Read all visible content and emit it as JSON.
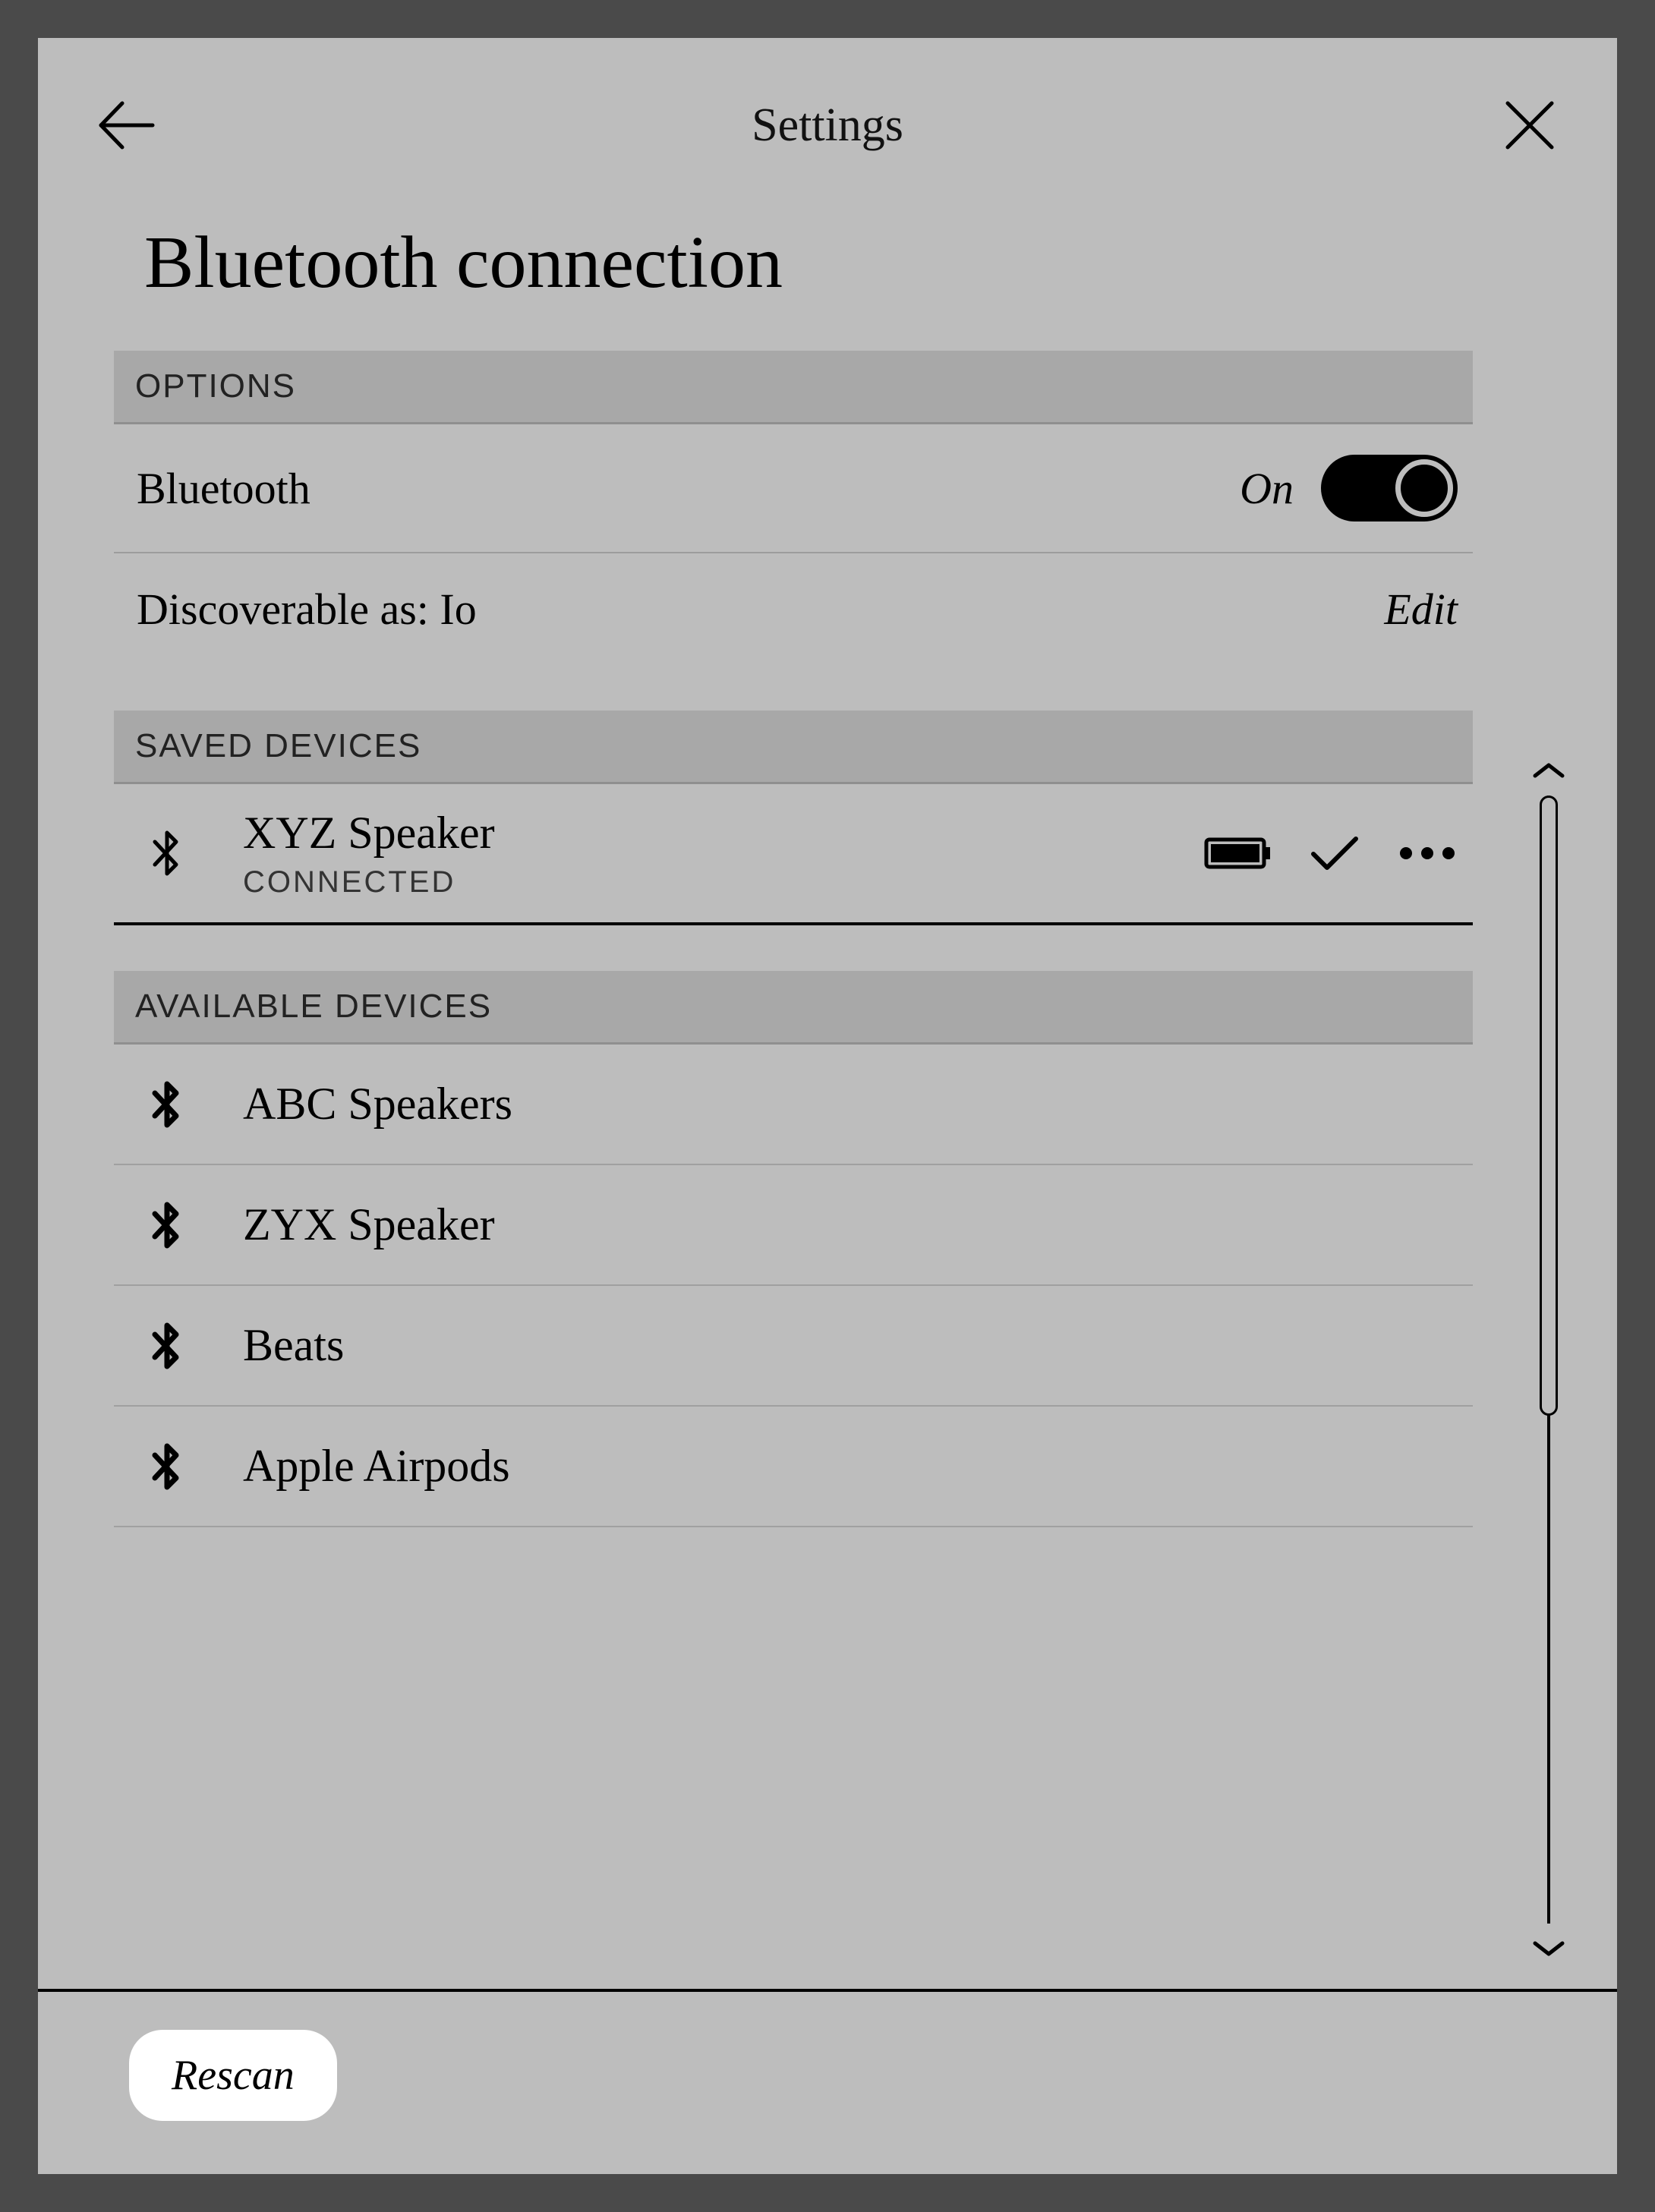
{
  "header": {
    "title": "Settings"
  },
  "page": {
    "title": "Bluetooth connection"
  },
  "sections": {
    "options_header": "OPTIONS",
    "saved_header": "SAVED DEVICES",
    "available_header": "AVAILABLE DEVICES"
  },
  "options": {
    "bluetooth_label": "Bluetooth",
    "bluetooth_state": "On",
    "discoverable_label": "Discoverable as: Io",
    "edit_label": "Edit"
  },
  "saved_devices": [
    {
      "name": "XYZ Speaker",
      "status": "CONNECTED"
    }
  ],
  "available_devices": [
    {
      "name": "ABC Speakers"
    },
    {
      "name": "ZYX Speaker"
    },
    {
      "name": "Beats"
    },
    {
      "name": "Apple Airpods"
    }
  ],
  "footer": {
    "rescan_label": "Rescan"
  }
}
